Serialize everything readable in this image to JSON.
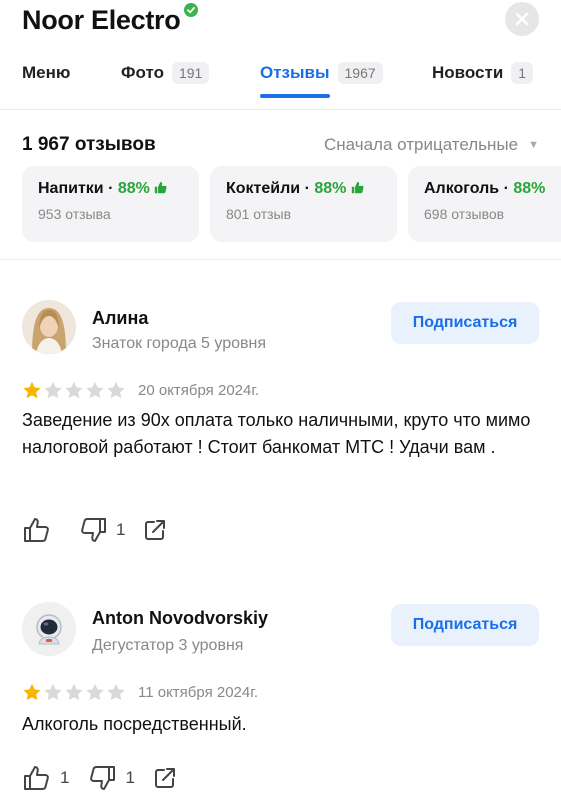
{
  "header": {
    "title": "Noor Electro"
  },
  "tabs": [
    {
      "label": "Меню",
      "count": ""
    },
    {
      "label": "Фото",
      "count": "191"
    },
    {
      "label": "Отзывы",
      "count": "1967"
    },
    {
      "label": "Новости",
      "count": "1"
    }
  ],
  "summary": {
    "total": "1 967 отзывов",
    "sort": "Сначала отрицательные"
  },
  "categories": [
    {
      "name": "Напитки",
      "percent": "88%",
      "sub": "953 отзыва"
    },
    {
      "name": "Коктейли",
      "percent": "88%",
      "sub": "801 отзыв"
    },
    {
      "name": "Алкоголь",
      "percent": "88%",
      "sub": "698 отзывов"
    }
  ],
  "reviews": [
    {
      "author": "Алина",
      "level": "Знаток города 5 уровня",
      "subscribe": "Подписаться",
      "rating": 1,
      "date": "20 октября 2024г.",
      "text": "Заведение из 90х  оплата только наличными, круто что мимо налоговой работают ! Стоит банкомат МТС ! Удачи вам .",
      "likes": "",
      "dislikes": "1"
    },
    {
      "author": "Anton Novodvorskiy",
      "level": "Дегустатор 3 уровня",
      "subscribe": "Подписаться",
      "rating": 1,
      "date": "11 октября 2024г.",
      "text": "Алкоголь посредственный.",
      "likes": "1",
      "dislikes": "1"
    }
  ],
  "colors": {
    "accent": "#1a6ee8",
    "positive": "#2aa53a",
    "star_filled": "#f7b500",
    "star_empty": "#d9d9d9"
  }
}
